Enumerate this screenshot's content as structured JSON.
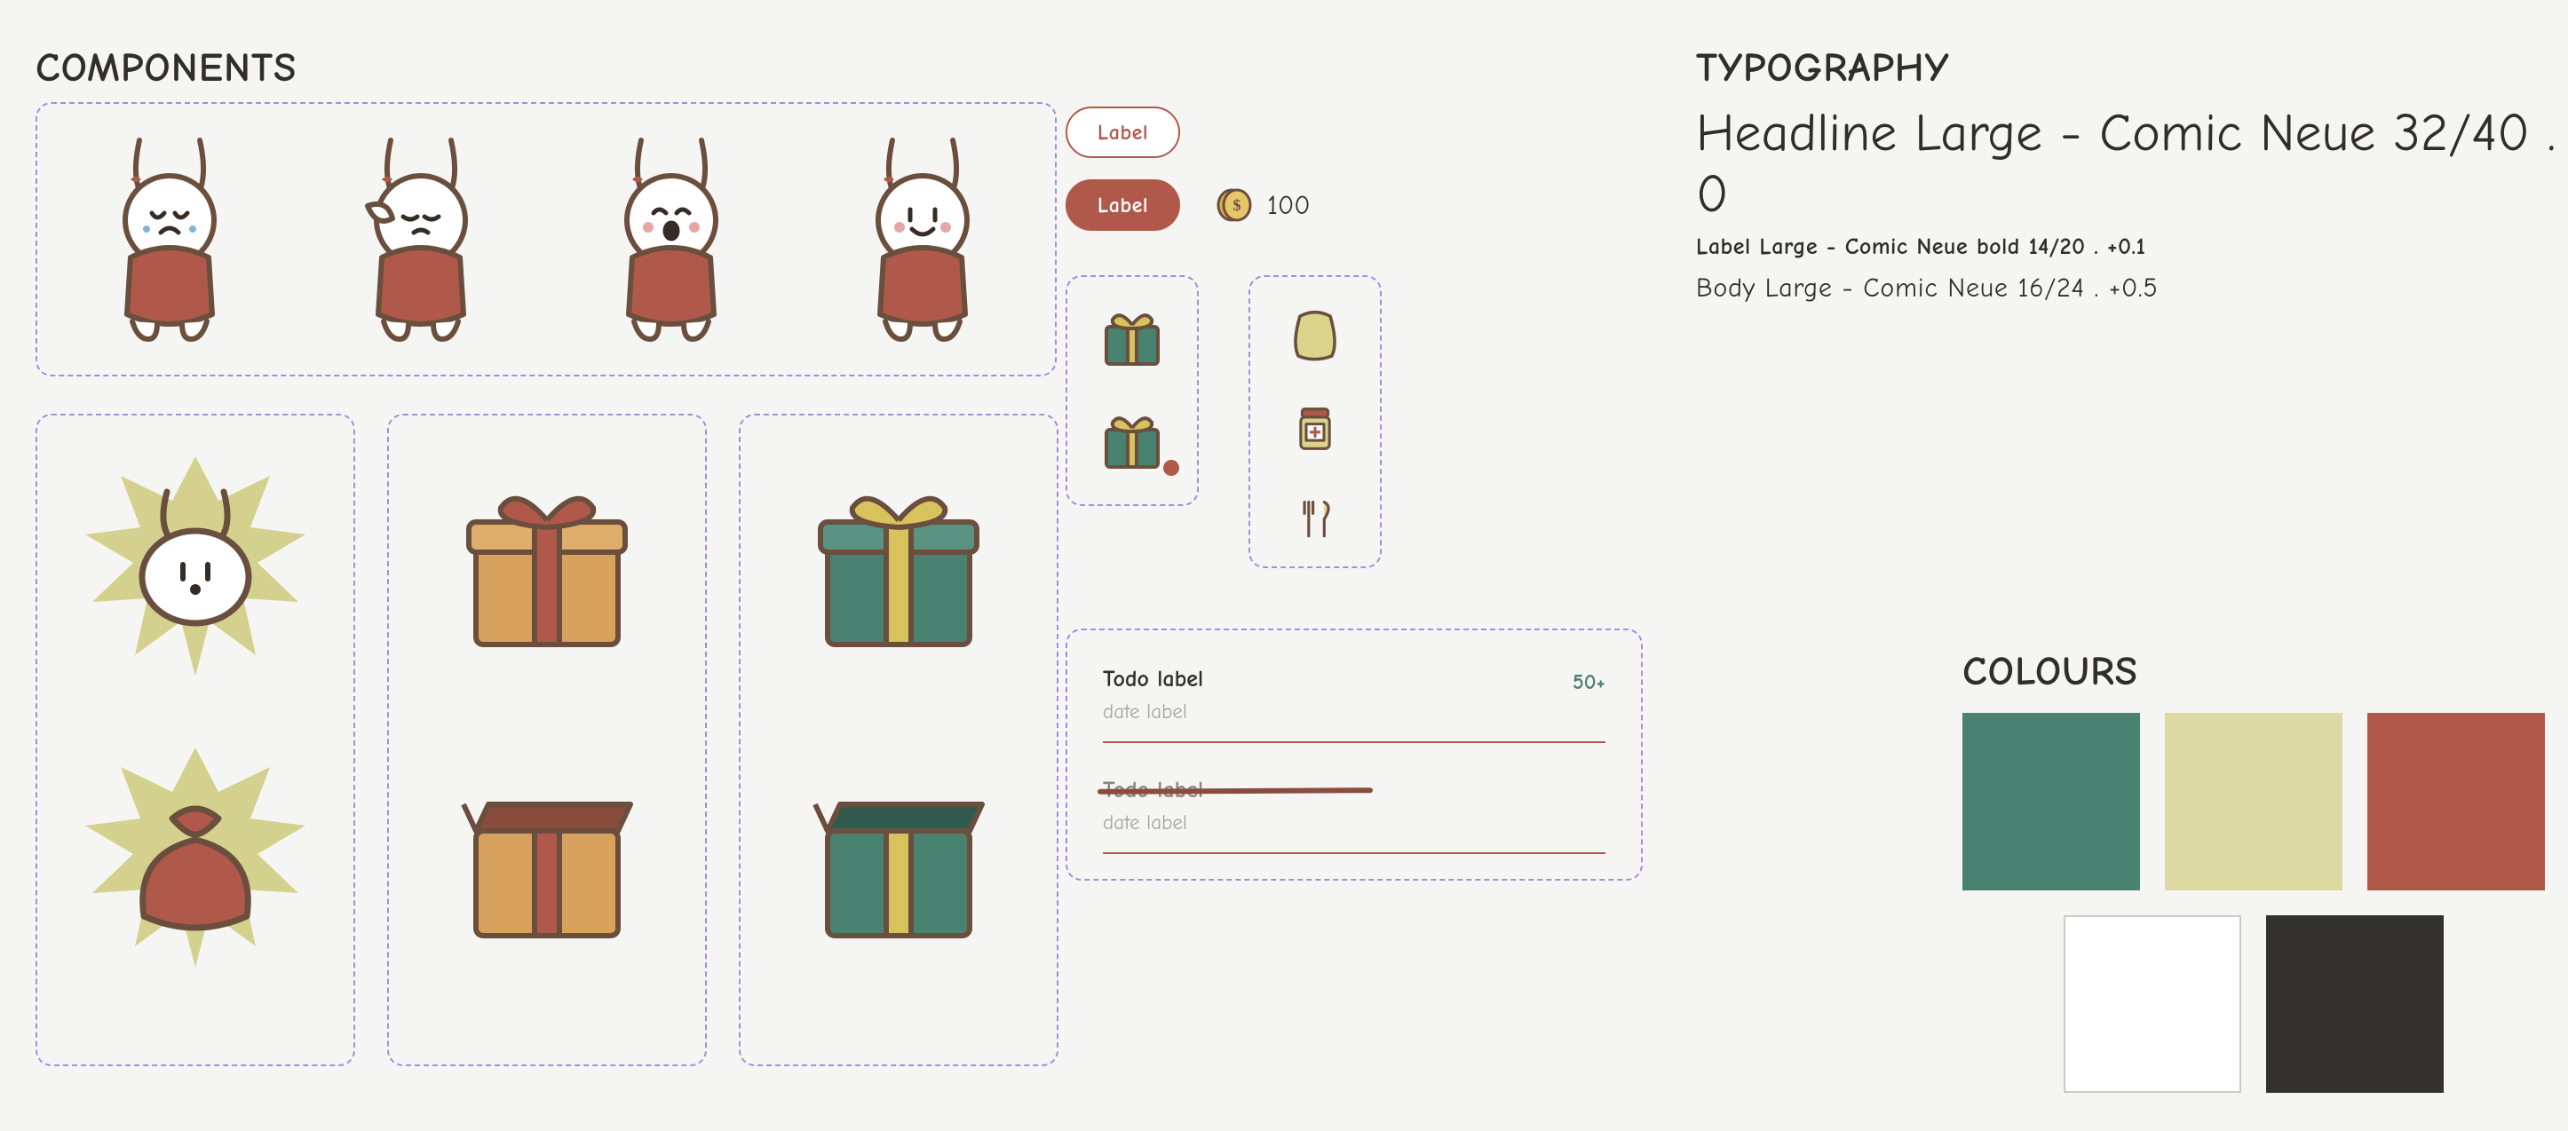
{
  "sections": {
    "components_title": "COMPONENTS",
    "typography_title": "TYPOGRAPHY",
    "colours_title": "COLOURS"
  },
  "typography": {
    "headline": "Headline Large - Comic Neue 32/40 . 0",
    "label": "Label Large - Comic Neue bold 14/20 . +0.1",
    "body": "Body Large - Comic Neue 16/24 . +0.5"
  },
  "chips": {
    "outline_label": "Label",
    "filled_label": "Label"
  },
  "currency": {
    "amount": "100",
    "icon": "coin-icon"
  },
  "bunnies": [
    {
      "icon": "bunny-cry-icon"
    },
    {
      "icon": "bunny-sad-icon"
    },
    {
      "icon": "bunny-sing-icon"
    },
    {
      "icon": "bunny-happy-icon"
    }
  ],
  "reward_cards": [
    {
      "top": "bunny-head-burst-icon",
      "bottom": "sack-burst-icon"
    },
    {
      "top": "gift-orange-closed-icon",
      "bottom": "gift-orange-open-icon"
    },
    {
      "top": "gift-green-closed-icon",
      "bottom": "gift-green-open-icon"
    }
  ],
  "inventory": {
    "col1": [
      {
        "icon": "gift-green-small-icon"
      },
      {
        "icon": "gift-green-small-icon",
        "dot": true
      }
    ],
    "col2": [
      {
        "icon": "clothes-icon"
      },
      {
        "icon": "pill-bottle-icon"
      },
      {
        "icon": "cutlery-icon"
      }
    ]
  },
  "todos": [
    {
      "title": "Todo label",
      "date": "date label",
      "count": "50+",
      "done": false
    },
    {
      "title": "Todo label",
      "date": "date label",
      "count": "",
      "done": true
    }
  ],
  "palette": {
    "row1": [
      "#4a8271",
      "#dcd9a2",
      "#b0594a"
    ],
    "row2": [
      "#ffffff",
      "#333230"
    ]
  }
}
